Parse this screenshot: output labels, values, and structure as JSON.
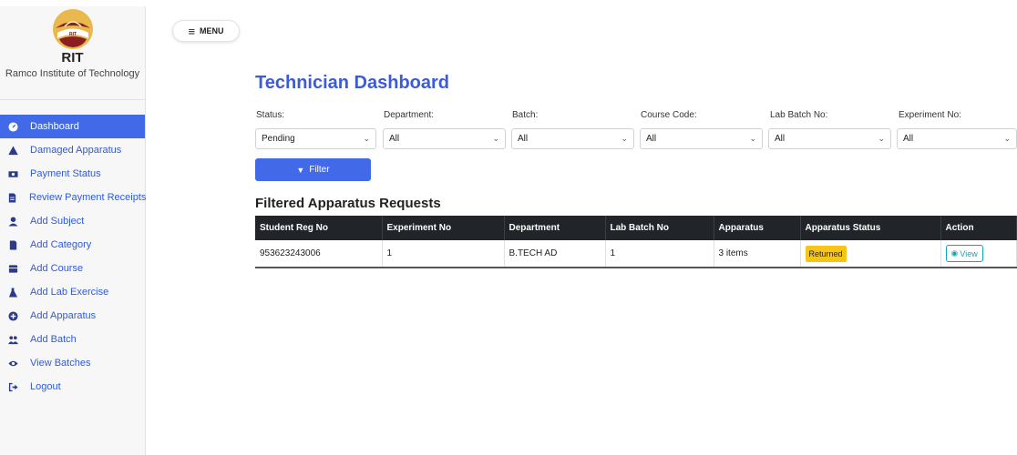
{
  "brand": {
    "short": "RIT",
    "full": "Ramco Institute of Technology",
    "logo_text": "RIT"
  },
  "colors": {
    "accent": "#4169e8",
    "title": "#3b5bdb",
    "badge": "#f5c518",
    "view": "#17a2b8"
  },
  "sidebar": {
    "items": [
      {
        "label": "Dashboard",
        "icon": "dashboard-icon",
        "active": true
      },
      {
        "label": "Damaged Apparatus",
        "icon": "warning-icon"
      },
      {
        "label": "Payment Status",
        "icon": "money-icon"
      },
      {
        "label": "Review Payment Receipts",
        "icon": "receipt-icon"
      },
      {
        "label": "Add Subject",
        "icon": "user-icon"
      },
      {
        "label": "Add Category",
        "icon": "document-icon"
      },
      {
        "label": "Add Course",
        "icon": "book-icon"
      },
      {
        "label": "Add Lab Exercise",
        "icon": "flask-icon"
      },
      {
        "label": "Add Apparatus",
        "icon": "plus-circle-icon"
      },
      {
        "label": "Add Batch",
        "icon": "users-icon"
      },
      {
        "label": "View Batches",
        "icon": "eye-icon"
      },
      {
        "label": "Logout",
        "icon": "logout-icon"
      }
    ]
  },
  "header": {
    "menu_label": "MENU"
  },
  "main": {
    "title": "Technician Dashboard",
    "filters": [
      {
        "label": "Status:",
        "value": "Pending"
      },
      {
        "label": "Department:",
        "value": "All"
      },
      {
        "label": "Batch:",
        "value": "All"
      },
      {
        "label": "Course Code:",
        "value": "All"
      },
      {
        "label": "Lab Batch No:",
        "value": "All"
      },
      {
        "label": "Experiment No:",
        "value": "All"
      }
    ],
    "filter_button": "Filter",
    "section_title": "Filtered Apparatus Requests",
    "table": {
      "headers": [
        "Student Reg No",
        "Experiment No",
        "Department",
        "Lab Batch No",
        "Apparatus",
        "Apparatus Status",
        "Action"
      ],
      "rows": [
        {
          "reg_no": "953623243006",
          "experiment_no": "1",
          "department": "B.TECH AD",
          "lab_batch_no": "1",
          "apparatus": "3 items",
          "status": "Returned",
          "action": "View"
        }
      ]
    }
  }
}
